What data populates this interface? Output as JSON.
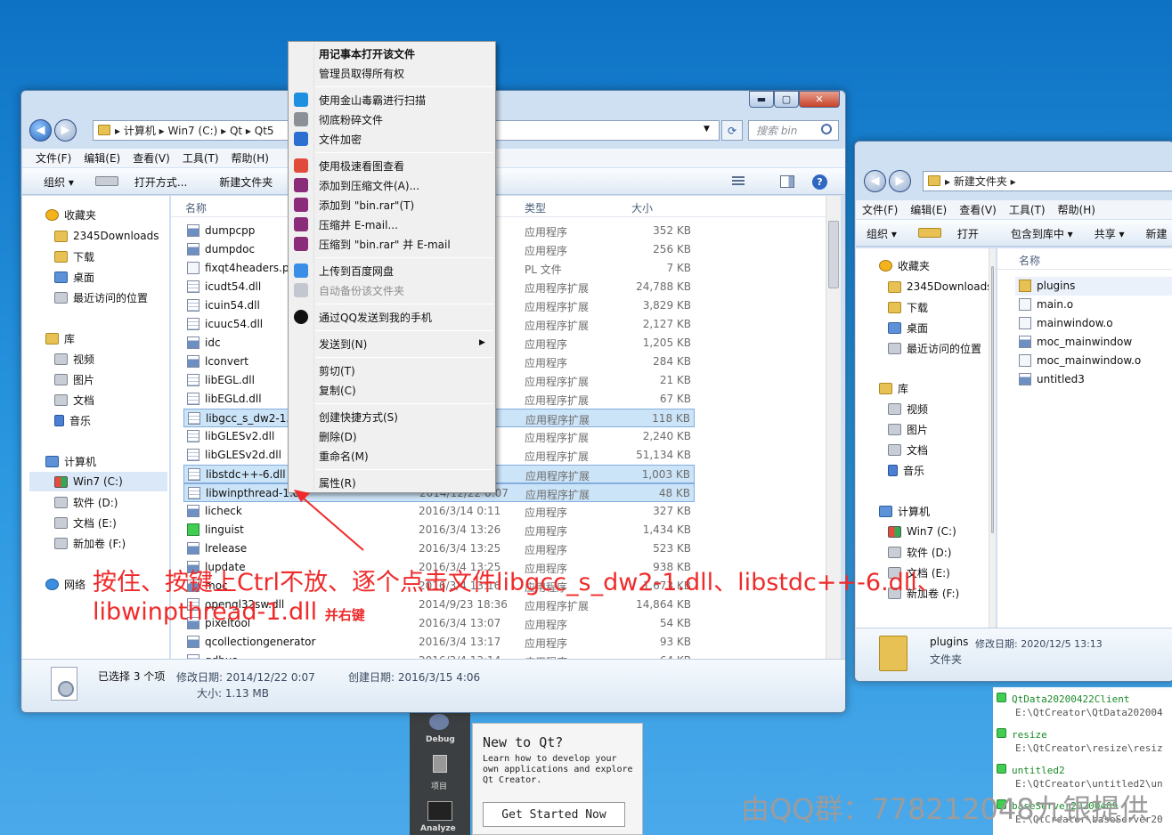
{
  "explorer_left": {
    "controls": [
      "▬",
      "▢",
      "✕"
    ],
    "address": [
      "计算机",
      "Win7 (C:)",
      "Qt",
      "Qt5"
    ],
    "search_placeholder": "搜索 bin",
    "menu": [
      "文件(F)",
      "编辑(E)",
      "查看(V)",
      "工具(T)",
      "帮助(H)"
    ],
    "toolbar": [
      "组织 ▾",
      "打开方式...",
      "新建文件夹"
    ],
    "columns": {
      "name": "名称",
      "type": "类型",
      "size": "大小"
    },
    "nav": {
      "favorites": "收藏夹",
      "fav_items": [
        "2345Downloads",
        "下载",
        "桌面",
        "最近访问的位置"
      ],
      "library": "库",
      "lib_items": [
        "视频",
        "图片",
        "文档",
        "音乐"
      ],
      "computer": "计算机",
      "drives": [
        "Win7 (C:)",
        "软件 (D:)",
        "文档 (E:)",
        "新加卷 (F:)"
      ],
      "network": "网络"
    },
    "files": [
      {
        "name": "dumpcpp",
        "date": "",
        "type": "应用程序",
        "size": "352 KB"
      },
      {
        "name": "dumpdoc",
        "date": "",
        "type": "应用程序",
        "size": "256 KB"
      },
      {
        "name": "fixqt4headers.pl",
        "date": "",
        "type": "PL 文件",
        "size": "7 KB"
      },
      {
        "name": "icudt54.dll",
        "date": "",
        "type": "应用程序扩展",
        "size": "24,788 KB"
      },
      {
        "name": "icuin54.dll",
        "date": "",
        "type": "应用程序扩展",
        "size": "3,829 KB"
      },
      {
        "name": "icuuc54.dll",
        "date": "",
        "type": "应用程序扩展",
        "size": "2,127 KB"
      },
      {
        "name": "idc",
        "date": "",
        "type": "应用程序",
        "size": "1,205 KB"
      },
      {
        "name": "lconvert",
        "date": "",
        "type": "应用程序",
        "size": "284 KB"
      },
      {
        "name": "libEGL.dll",
        "date": "",
        "type": "应用程序扩展",
        "size": "21 KB"
      },
      {
        "name": "libEGLd.dll",
        "date": "",
        "type": "应用程序扩展",
        "size": "67 KB"
      },
      {
        "name": "libgcc_s_dw2-1.dll",
        "date": "",
        "type": "应用程序扩展",
        "size": "118 KB"
      },
      {
        "name": "libGLESv2.dll",
        "date": "",
        "type": "应用程序扩展",
        "size": "2,240 KB"
      },
      {
        "name": "libGLESv2d.dll",
        "date": "",
        "type": "应用程序扩展",
        "size": "51,134 KB"
      },
      {
        "name": "libstdc++-6.dll",
        "date": "",
        "type": "应用程序扩展",
        "size": "1,003 KB"
      },
      {
        "name": "libwinpthread-1.dll",
        "date": "2014/12/22 0:07",
        "type": "应用程序扩展",
        "size": "48 KB"
      },
      {
        "name": "licheck",
        "date": "2016/3/14 0:11",
        "type": "应用程序",
        "size": "327 KB"
      },
      {
        "name": "linguist",
        "date": "2016/3/4 13:26",
        "type": "应用程序",
        "size": "1,434 KB"
      },
      {
        "name": "lrelease",
        "date": "2016/3/4 13:25",
        "type": "应用程序",
        "size": "523 KB"
      },
      {
        "name": "lupdate",
        "date": "2016/3/4 13:25",
        "type": "应用程序",
        "size": "938 KB"
      },
      {
        "name": "moc",
        "date": "2016/3/4 13:16",
        "type": "应用程序",
        "size": "1,673 KB"
      },
      {
        "name": "opengl32sw.dll",
        "date": "2014/9/23 18:36",
        "type": "应用程序扩展",
        "size": "14,864 KB"
      },
      {
        "name": "pixeltool",
        "date": "2016/3/4 13:07",
        "type": "应用程序",
        "size": "54 KB"
      },
      {
        "name": "qcollectiongenerator",
        "date": "2016/3/4 13:17",
        "type": "应用程序",
        "size": "93 KB"
      },
      {
        "name": "qdbus",
        "date": "2016/3/4 13:14",
        "type": "应用程序",
        "size": "64 KB"
      }
    ],
    "status": {
      "selected": "已选择 3 个项",
      "modified": "修改日期: 2014/12/22 0:07",
      "created": "创建日期: 2016/3/15 4:06",
      "size": "大小: 1.13 MB"
    }
  },
  "context_menu": {
    "items": [
      "用记事本打开该文件",
      "管理员取得所有权",
      "使用金山毒霸进行扫描",
      "彻底粉碎文件",
      "文件加密",
      "使用极速看图查看",
      "添加到压缩文件(A)...",
      "添加到 \"bin.rar\"(T)",
      "压缩并 E-mail...",
      "压缩到 \"bin.rar\" 并 E-mail",
      "上传到百度网盘",
      "自动备份该文件夹",
      "通过QQ发送到我的手机",
      "发送到(N)",
      "剪切(T)",
      "复制(C)",
      "创建快捷方式(S)",
      "删除(D)",
      "重命名(M)",
      "属性(R)"
    ],
    "submenu_arrow": "▶"
  },
  "explorer_right": {
    "address": "新建文件夹",
    "menu": [
      "文件(F)",
      "编辑(E)",
      "查看(V)",
      "工具(T)",
      "帮助(H)"
    ],
    "toolbar": [
      "组织 ▾",
      "打开",
      "包含到库中 ▾",
      "共享 ▾",
      "新建"
    ],
    "column": "名称",
    "nav": {
      "favorites": "收藏夹",
      "fav_items": [
        "2345Downloads",
        "下载",
        "桌面",
        "最近访问的位置"
      ],
      "library": "库",
      "lib_items": [
        "视频",
        "图片",
        "文档",
        "音乐"
      ],
      "computer": "计算机",
      "drives": [
        "Win7 (C:)",
        "软件 (D:)",
        "文档 (E:)",
        "新加卷 (F:)"
      ]
    },
    "files": [
      "plugins",
      "main.o",
      "mainwindow.o",
      "moc_mainwindow",
      "moc_mainwindow.o",
      "untitled3"
    ],
    "details": {
      "name": "plugins",
      "modified": "修改日期: 2020/12/5 13:13",
      "type": "文件夹"
    }
  },
  "annotation": {
    "line1": "按住、按键上Ctrl不放、逐个点击文件libgcc_s_dw2-1.dll、libstdc++-6.dll、",
    "line2": "libwinpthread-1.dll",
    "line2_small": "并右键"
  },
  "qt": {
    "welcome_title": "New to Qt?",
    "welcome_text": "Learn how to develop your own applications and explore Qt Creator.",
    "get_started": "Get Started Now",
    "sidebar": [
      "Debug",
      "项目",
      "Analyze"
    ],
    "recent": [
      {
        "name": "QtData20200422Client",
        "path": "E:\\QtCreator\\QtData202004"
      },
      {
        "name": "resize",
        "path": "E:\\QtCreator\\resize\\resiz"
      },
      {
        "name": "untitled2",
        "path": "E:\\QtCreator\\untitled2\\un"
      },
      {
        "name": "baseServer20200409",
        "path": "E:\\QtCreator\\baseServer20"
      }
    ]
  },
  "watermark": "由QQ群：778212048九银提供"
}
